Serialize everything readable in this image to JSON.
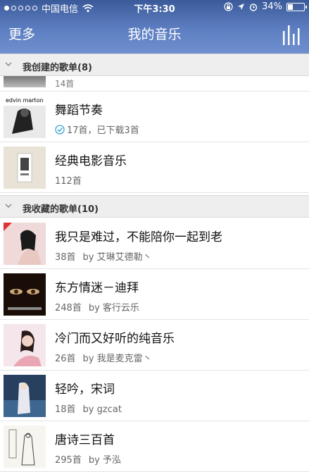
{
  "status": {
    "carrier": "中国电信",
    "time": "下午3:30",
    "battery": "34%",
    "battery_level": 0.34
  },
  "nav": {
    "back": "更多",
    "title": "我的音乐"
  },
  "created": {
    "section_label": "我创建的歌单(8)",
    "partial_sub": "14首",
    "items": [
      {
        "title": "舞蹈节奏",
        "count": "17首，已下载3首",
        "by": "",
        "thumb_text": "edvin marton"
      },
      {
        "title": "经典电影音乐",
        "count": "112首",
        "by": ""
      }
    ]
  },
  "collected": {
    "section_label": "我收藏的歌单(10)",
    "items": [
      {
        "title": "我只是难过，不能陪你一起到老",
        "count": "38首",
        "by": "by 艾琳艾德勒丶"
      },
      {
        "title": "东方情迷－迪拜",
        "count": "248首",
        "by": "by 客行云乐"
      },
      {
        "title": "冷门而又好听的纯音乐",
        "count": "26首",
        "by": "by 我是麦克雷丶"
      },
      {
        "title": "轻吟，宋词",
        "count": "18首",
        "by": "by gzcat"
      },
      {
        "title": "唐诗三百首",
        "count": "295首",
        "by": "by 予泓"
      }
    ]
  },
  "colors": {
    "header": "#4d6fb4",
    "section_bg": "#eeeeee"
  }
}
